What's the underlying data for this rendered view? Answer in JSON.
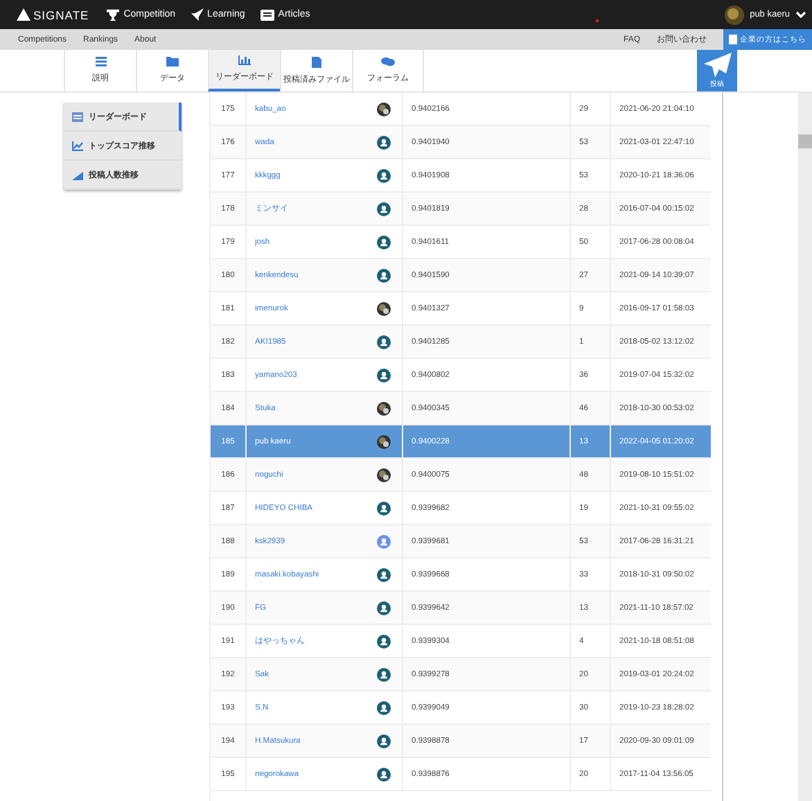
{
  "header": {
    "logo": "SIGNATE",
    "nav": [
      {
        "label": "Competition"
      },
      {
        "label": "Learning"
      },
      {
        "label": "Articles"
      }
    ],
    "user": "pub kaeru"
  },
  "subnav": {
    "links": [
      "Competitions",
      "Rankings",
      "About"
    ],
    "right_links": [
      "FAQ",
      "お問い合わせ"
    ],
    "corporate_button": "企業の方はこちら"
  },
  "tabs": [
    {
      "label": "説明",
      "selected": false
    },
    {
      "label": "データ",
      "selected": false
    },
    {
      "label": "リーダーボード",
      "selected": true
    },
    {
      "label": "投稿済みファイル",
      "selected": false
    },
    {
      "label": "フォーラム",
      "selected": false
    }
  ],
  "post_button": "投稿",
  "sidebar": [
    {
      "label": "リーダーボード",
      "selected": true
    },
    {
      "label": "トップスコア推移",
      "selected": false
    },
    {
      "label": "投稿人数推移",
      "selected": false
    }
  ],
  "rows": [
    {
      "rank": "175",
      "name": "kabu_ao",
      "kind": "photo",
      "score": "0.9402166",
      "count": "29",
      "date": "2021-06-20 21:04:10",
      "selected": false
    },
    {
      "rank": "176",
      "name": "wada",
      "kind": "default",
      "score": "0.9401940",
      "count": "53",
      "date": "2021-03-01 22:47:10",
      "selected": false
    },
    {
      "rank": "177",
      "name": "kkkggg",
      "kind": "default",
      "score": "0.9401908",
      "count": "53",
      "date": "2020-10-21 18:36:06",
      "selected": false
    },
    {
      "rank": "178",
      "name": "ミンサイ",
      "kind": "default",
      "score": "0.9401819",
      "count": "28",
      "date": "2016-07-04 00:15:02",
      "selected": false
    },
    {
      "rank": "179",
      "name": "josh",
      "kind": "default",
      "score": "0.9401611",
      "count": "50",
      "date": "2017-06-28 00:08:04",
      "selected": false
    },
    {
      "rank": "180",
      "name": "kenkendesu",
      "kind": "default",
      "score": "0.9401590",
      "count": "27",
      "date": "2021-09-14 10:39:07",
      "selected": false
    },
    {
      "rank": "181",
      "name": "imenurok",
      "kind": "photo",
      "score": "0.9401327",
      "count": "9",
      "date": "2016-09-17 01:58:03",
      "selected": false
    },
    {
      "rank": "182",
      "name": "AKI1985",
      "kind": "default",
      "score": "0.9401285",
      "count": "1",
      "date": "2018-05-02 13:12:02",
      "selected": false
    },
    {
      "rank": "183",
      "name": "yamano203",
      "kind": "default",
      "score": "0.9400802",
      "count": "36",
      "date": "2019-07-04 15:32:02",
      "selected": false
    },
    {
      "rank": "184",
      "name": "Stuka",
      "kind": "photo",
      "score": "0.9400345",
      "count": "46",
      "date": "2018-10-30 00:53:02",
      "selected": false
    },
    {
      "rank": "185",
      "name": "pub kaeru",
      "kind": "photo",
      "score": "0.9400228",
      "count": "13",
      "date": "2022-04-05 01:20:02",
      "selected": true
    },
    {
      "rank": "186",
      "name": "noguchi",
      "kind": "photo",
      "score": "0.9400075",
      "count": "48",
      "date": "2019-08-10 15:51:02",
      "selected": false
    },
    {
      "rank": "187",
      "name": "HIDEYO CHIBA",
      "kind": "default",
      "score": "0.9399682",
      "count": "19",
      "date": "2021-10-31 09:55:02",
      "selected": false
    },
    {
      "rank": "188",
      "name": "ksk2939",
      "kind": "blue",
      "score": "0.9399681",
      "count": "53",
      "date": "2017-06-28 16:31:21",
      "selected": false
    },
    {
      "rank": "189",
      "name": "masaki.kobayashi",
      "kind": "default",
      "score": "0.9399668",
      "count": "33",
      "date": "2018-10-31 09:50:02",
      "selected": false
    },
    {
      "rank": "190",
      "name": "FG",
      "kind": "default",
      "score": "0.9399642",
      "count": "13",
      "date": "2021-11-10 18:57:02",
      "selected": false
    },
    {
      "rank": "191",
      "name": "はやっちゃん",
      "kind": "default",
      "score": "0.9399304",
      "count": "4",
      "date": "2021-10-18 08:51:08",
      "selected": false
    },
    {
      "rank": "192",
      "name": "Sak",
      "kind": "default",
      "score": "0.9399278",
      "count": "20",
      "date": "2019-03-01 20:24:02",
      "selected": false
    },
    {
      "rank": "193",
      "name": "S.N",
      "kind": "default",
      "score": "0.9399049",
      "count": "30",
      "date": "2019-10-23 18:28:02",
      "selected": false
    },
    {
      "rank": "194",
      "name": "H.Matsukura",
      "kind": "default",
      "score": "0.9398878",
      "count": "17",
      "date": "2020-09-30 09:01:09",
      "selected": false
    },
    {
      "rank": "195",
      "name": "negorokawa",
      "kind": "default",
      "score": "0.9398876",
      "count": "20",
      "date": "2017-11-04 13:56:05",
      "selected": false
    }
  ]
}
